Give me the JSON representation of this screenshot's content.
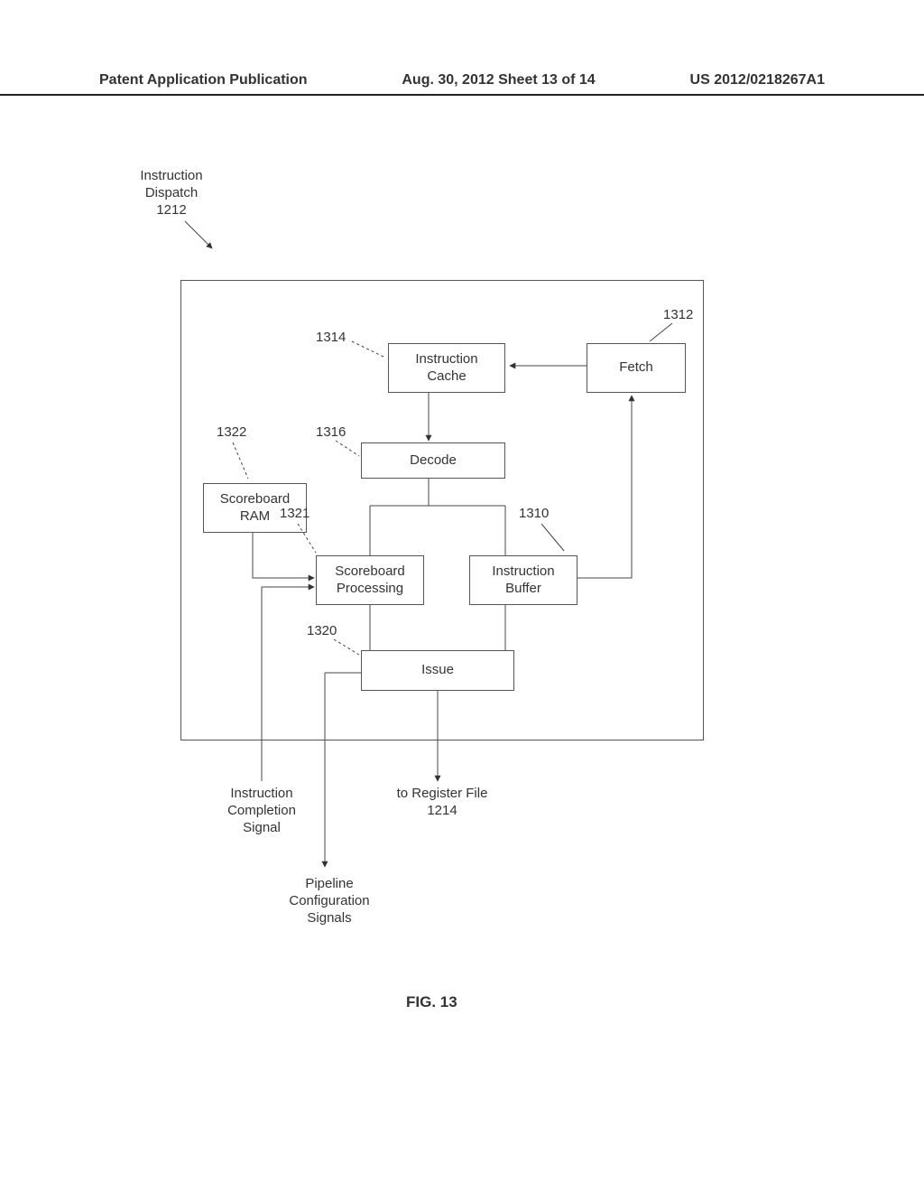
{
  "header": {
    "left": "Patent Application Publication",
    "center": "Aug. 30, 2012  Sheet 13 of 14",
    "right": "US 2012/0218267A1"
  },
  "title_label": "Instruction\nDispatch\n1212",
  "refs": {
    "r1312": "1312",
    "r1314": "1314",
    "r1322": "1322",
    "r1316": "1316",
    "r1321": "1321",
    "r1310": "1310",
    "r1320": "1320"
  },
  "boxes": {
    "fetch": "Fetch",
    "icache": "Instruction\nCache",
    "decode": "Decode",
    "sram": "Scoreboard\nRAM",
    "sproc": "Scoreboard\nProcessing",
    "ibuf": "Instruction\nBuffer",
    "issue": "Issue"
  },
  "out_labels": {
    "comp": "Instruction\nCompletion\nSignal",
    "pcfg": "Pipeline\nConfiguration\nSignals",
    "rfile": "to Register File\n1214"
  },
  "figure": "FIG. 13"
}
